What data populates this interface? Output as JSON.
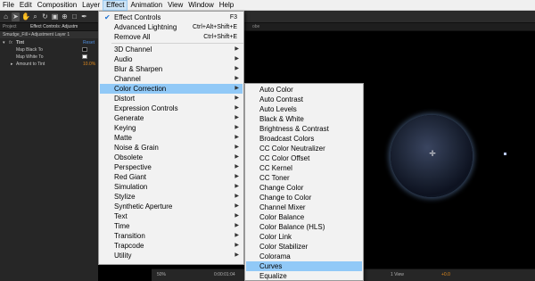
{
  "menubar": {
    "items": [
      "File",
      "Edit",
      "Composition",
      "Layer",
      "Effect",
      "Animation",
      "View",
      "Window",
      "Help"
    ]
  },
  "left_panel": {
    "tabs": [
      "Project",
      "Effect Controls: Adjustm"
    ],
    "layer_path": "Smudge_Fill • Adjustment Layer 1",
    "effect_name": "Tint",
    "reset_label": "Reset",
    "props": [
      {
        "label": "Map Black To"
      },
      {
        "label": "Map White To"
      },
      {
        "label": "Amount to Tint",
        "value": "10.0%"
      }
    ]
  },
  "viewer": {
    "tab_label": "obe",
    "footer": {
      "zoom": "50%",
      "timecode": "0:00:01:04",
      "view": "1 View",
      "exposure": "+0.0"
    }
  },
  "effect_menu": {
    "top_items": [
      {
        "label": "Effect Controls",
        "shortcut": "F3",
        "checked": true
      },
      {
        "label": "Advanced Lightning",
        "shortcut": "Ctrl+Alt+Shift+E"
      },
      {
        "label": "Remove All",
        "shortcut": "Ctrl+Shift+E"
      }
    ],
    "categories": [
      "3D Channel",
      "Audio",
      "Blur & Sharpen",
      "Channel",
      "Color Correction",
      "Distort",
      "Expression Controls",
      "Generate",
      "Keying",
      "Matte",
      "Noise & Grain",
      "Obsolete",
      "Perspective",
      "Red Giant",
      "Simulation",
      "Stylize",
      "Synthetic Aperture",
      "Text",
      "Time",
      "Transition",
      "Trapcode",
      "Utility"
    ],
    "highlighted_category": "Color Correction"
  },
  "color_correction_submenu": {
    "items": [
      "Auto Color",
      "Auto Contrast",
      "Auto Levels",
      "Black & White",
      "Brightness & Contrast",
      "Broadcast Colors",
      "CC Color Neutralizer",
      "CC Color Offset",
      "CC Kernel",
      "CC Toner",
      "Change Color",
      "Change to Color",
      "Channel Mixer",
      "Color Balance",
      "Color Balance (HLS)",
      "Color Link",
      "Color Stabilizer",
      "Colorama",
      "Curves",
      "Equalize"
    ],
    "highlighted_item": "Curves"
  }
}
